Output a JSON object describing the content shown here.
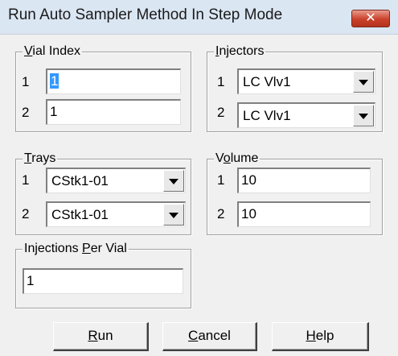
{
  "window": {
    "title": "Run Auto Sampler Method In Step Mode",
    "close_glyph": "✕"
  },
  "vial_index": {
    "legend_prefix": "",
    "legend_mnemonic": "V",
    "legend_rest": "ial Index",
    "rows": [
      {
        "num": "1",
        "value": "1",
        "selected": true
      },
      {
        "num": "2",
        "value": "1",
        "selected": false
      }
    ]
  },
  "injectors": {
    "legend_prefix": "",
    "legend_mnemonic": "I",
    "legend_rest": "njectors",
    "rows": [
      {
        "num": "1",
        "value": "LC Vlv1"
      },
      {
        "num": "2",
        "value": "LC Vlv1"
      }
    ]
  },
  "trays": {
    "legend_prefix": "",
    "legend_mnemonic": "T",
    "legend_rest": "rays",
    "rows": [
      {
        "num": "1",
        "value": "CStk1-01"
      },
      {
        "num": "2",
        "value": "CStk1-01"
      }
    ]
  },
  "volume": {
    "legend_prefix": "V",
    "legend_mnemonic": "o",
    "legend_rest": "lume",
    "rows": [
      {
        "num": "1",
        "value": "10"
      },
      {
        "num": "2",
        "value": "10"
      }
    ]
  },
  "injections_per_vial": {
    "legend_prefix": "Injections ",
    "legend_mnemonic": "P",
    "legend_rest": "er Vial",
    "value": "1"
  },
  "buttons": {
    "run": {
      "mnemonic": "R",
      "rest": "un"
    },
    "cancel": {
      "mnemonic": "C",
      "rest": "ancel"
    },
    "help": {
      "mnemonic": "H",
      "rest": "elp"
    }
  },
  "icons": {
    "close": "close-icon",
    "dropdown": "chevron-down-icon"
  },
  "colors": {
    "titlebar": "#dbe6f3",
    "close_button": "#c9412b",
    "selection": "#3399ff",
    "dialog_bg": "#f0f0f0"
  }
}
